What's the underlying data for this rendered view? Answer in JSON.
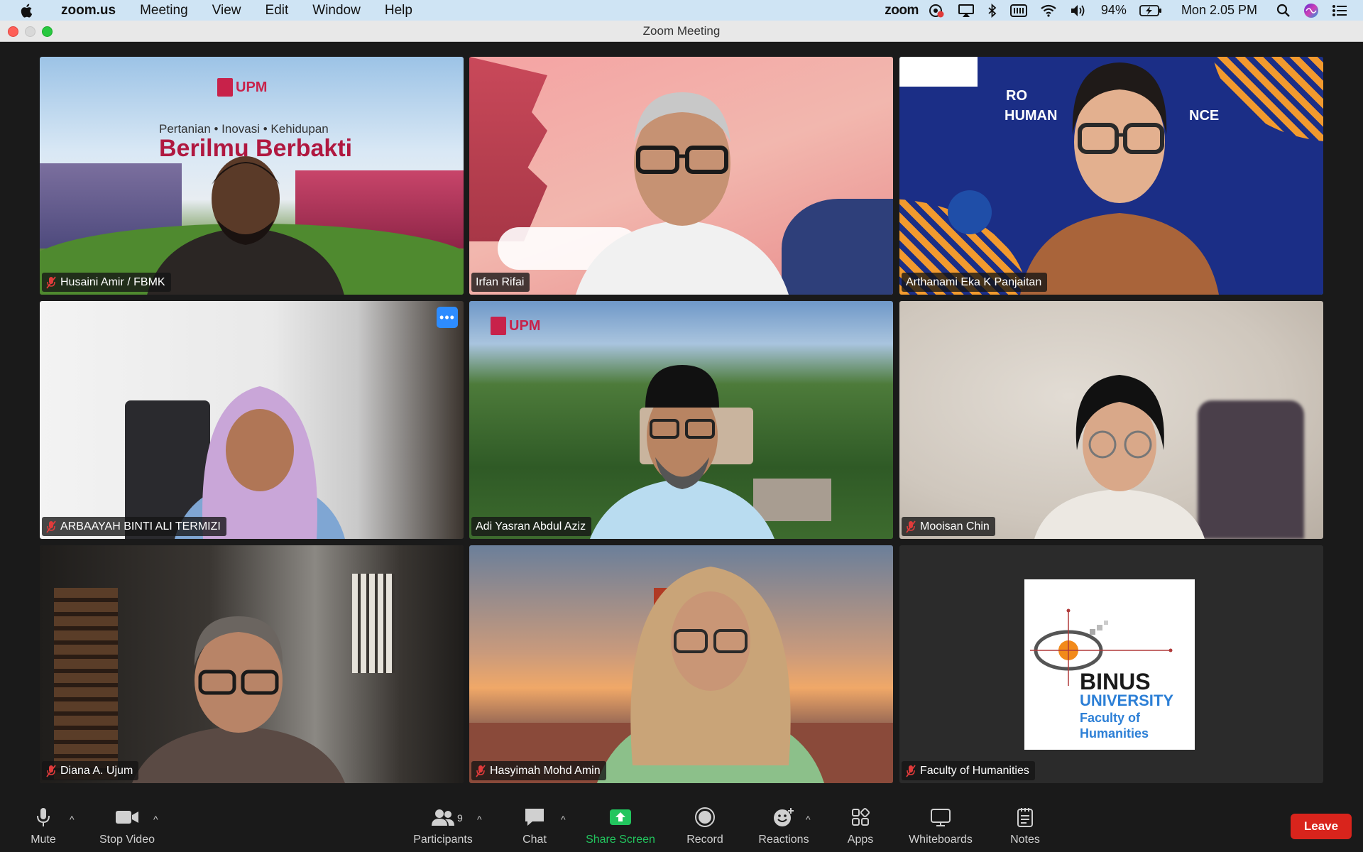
{
  "menubar": {
    "app_name": "zoom.us",
    "items": [
      "Meeting",
      "View",
      "Edit",
      "Window",
      "Help"
    ],
    "zoom_status": "zoom",
    "battery": "94%",
    "clock": "Mon 2.05 PM"
  },
  "window": {
    "title": "Zoom Meeting"
  },
  "tiles": [
    {
      "name": "Husaini Amir /  FBMK",
      "muted": true,
      "background_text": {
        "tagline": "Pertanian • Inovasi • Kehidupan",
        "motto": "Berilmu Berbakti",
        "logo": "UPM"
      }
    },
    {
      "name": "Irfan Rifai",
      "muted": false
    },
    {
      "name": "Arthanami Eka K Panjaitan",
      "muted": false,
      "active_speaker": true,
      "slide_text": {
        "line1": "RO",
        "line2": "HUMAN",
        "line3": "NCE"
      }
    },
    {
      "name": "ARBAAYAH BINTI ALI TERMIZI",
      "muted": true,
      "more_label": "•••"
    },
    {
      "name": "Adi Yasran Abdul Aziz",
      "muted": false,
      "logo": "UPM"
    },
    {
      "name": "Mooisan Chin",
      "muted": true
    },
    {
      "name": "Diana A. Ujum",
      "muted": true
    },
    {
      "name": "Hasyimah Mohd Amin",
      "muted": true
    },
    {
      "name": "Faculty of Humanities",
      "muted": true,
      "card": {
        "brand": "BINUS",
        "university": "UNIVERSITY",
        "faculty_line1": "Faculty of",
        "faculty_line2": "Humanities"
      }
    }
  ],
  "toolbar": {
    "mute": "Mute",
    "stop_video": "Stop Video",
    "participants": "Participants",
    "participants_count": "9",
    "chat": "Chat",
    "share_screen": "Share Screen",
    "record": "Record",
    "reactions": "Reactions",
    "apps": "Apps",
    "whiteboards": "Whiteboards",
    "notes": "Notes",
    "leave": "Leave"
  },
  "colors": {
    "active_speaker_border": "#23d160",
    "share_green": "#22c55e",
    "leave_red": "#d9241c",
    "more_blue": "#2d8cff",
    "mute_red": "#e03b3b"
  }
}
